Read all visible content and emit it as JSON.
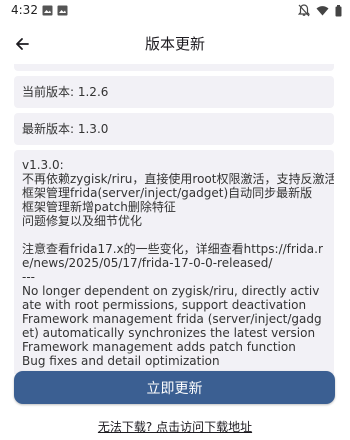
{
  "status_bar": {
    "time": "4:32",
    "left_icons": [
      "photo-icon",
      "image-icon"
    ],
    "right_icons": [
      "notifications-off-icon",
      "wifi-icon",
      "battery-icon"
    ]
  },
  "app_bar": {
    "title": "版本更新",
    "back_icon": "arrow-back-icon"
  },
  "versions": {
    "current": "当前版本: 1.2.6",
    "latest": "最新版本: 1.3.0"
  },
  "release_notes": {
    "lines": [
      "v1.3.0:",
      "不再依赖zygisk/riru，直接使用root权限激活，支持反激活",
      "框架管理frida(server/inject/gadget)自动同步最新版",
      "框架管理新增patch删除特征",
      "问题修复以及细节优化",
      "",
      "注意查看frida17.x的一些变化，详细查看https://frida.re/news/2025/05/17/frida-17-0-0-released/",
      "---",
      "No longer dependent on zygisk/riru, directly activate with root permissions, support deactivation",
      "Framework management frida (server/inject/gadget) automatically synchronizes the latest version",
      "Framework management adds patch function",
      "Bug fixes and detail optimization"
    ]
  },
  "actions": {
    "update_label": "立即更新",
    "download_link": "无法下载? 点击访问下载地址"
  },
  "colors": {
    "primary": "#3b5f92",
    "card_bg": "#f2f1f6"
  }
}
